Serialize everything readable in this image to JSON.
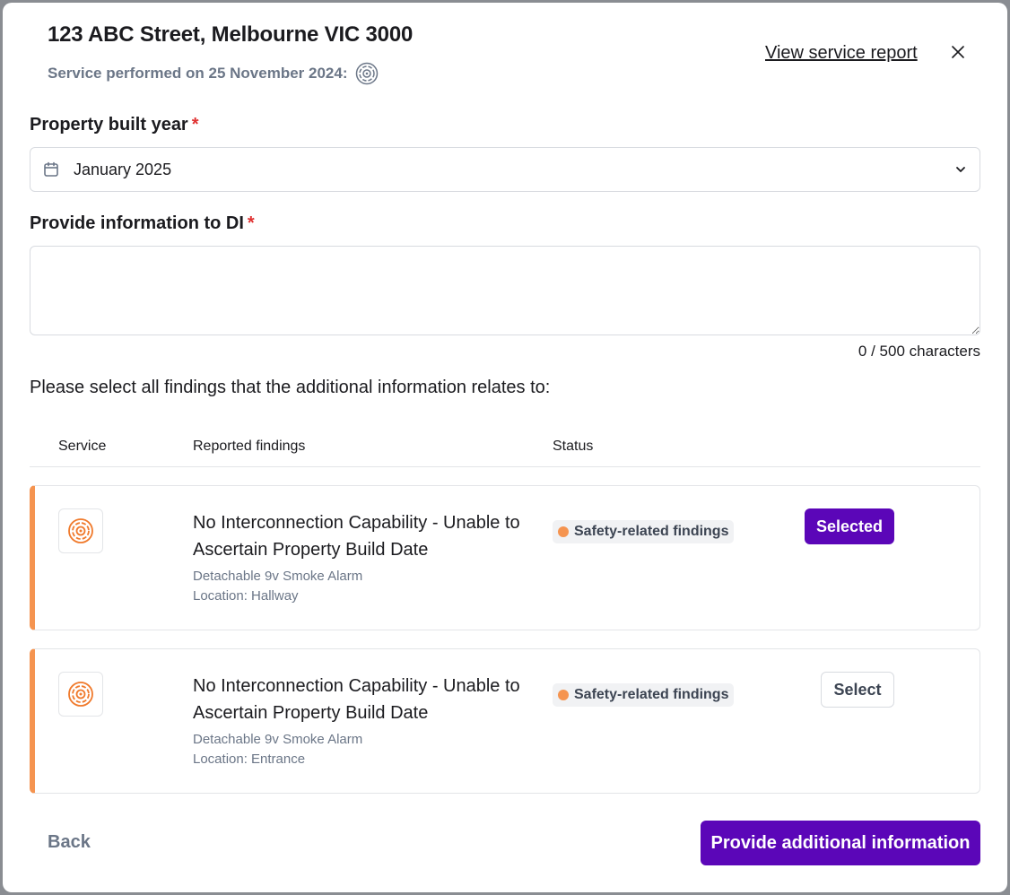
{
  "header": {
    "title": "123 ABC Street, Melbourne VIC 3000",
    "subtitle": "Service performed on 25 November 2024:",
    "service_icon": "smoke-alarm-icon",
    "report_link": "View service report",
    "close_icon": "close-icon"
  },
  "form": {
    "year_label": "Property built year",
    "year_required": "*",
    "year_value": "January 2025",
    "info_label": "Provide information to DI",
    "info_required": "*",
    "info_value": "",
    "char_count": "0 / 500 characters"
  },
  "findings": {
    "prompt": "Please select all findings that the additional information relates to:",
    "columns": [
      "Service",
      "Reported findings",
      "Status"
    ],
    "rows": [
      {
        "icon": "smoke-alarm-icon",
        "title": "No Interconnection Capability - Unable to Ascertain Property Build Date",
        "device": "Detachable 9v Smoke Alarm",
        "location": "Location: Hallway",
        "status": "Safety-related findings",
        "button": "Selected",
        "selected": true
      },
      {
        "icon": "smoke-alarm-icon",
        "title": "No Interconnection Capability - Unable to Ascertain Property Build Date",
        "device": "Detachable 9v Smoke Alarm",
        "location": "Location: Entrance",
        "status": "Safety-related findings",
        "button": "Select",
        "selected": false
      }
    ]
  },
  "footer": {
    "back_label": "Back",
    "primary_label": "Provide additional information"
  },
  "colors": {
    "accent": "#5b06b8",
    "status_orange": "#f59450",
    "required_red": "#e03131"
  }
}
